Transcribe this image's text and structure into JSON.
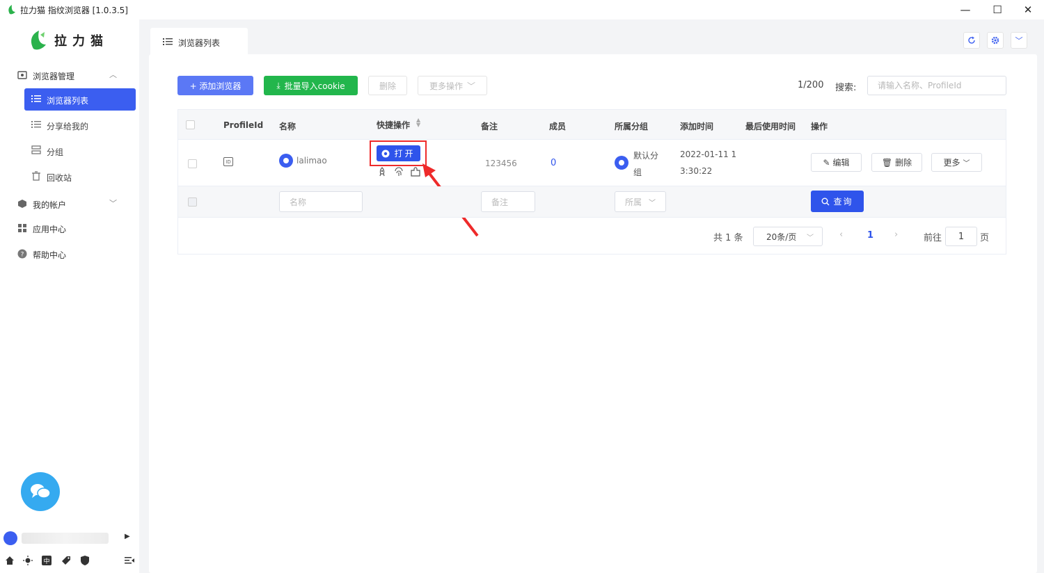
{
  "window": {
    "title": "拉力猫 指纹浏览器  [1.0.3.5]",
    "minimize": "—",
    "maximize": "☐",
    "close": "✕"
  },
  "sidebar": {
    "logo_text": "拉力猫",
    "groups": [
      {
        "label": "浏览器管理",
        "icon": "browser-manage-icon",
        "expanded": true
      },
      {
        "label": "我的帐户",
        "icon": "account-icon",
        "expanded": false
      },
      {
        "label": "应用中心",
        "icon": "app-center-icon"
      },
      {
        "label": "帮助中心",
        "icon": "help-icon"
      }
    ],
    "sub_items": [
      {
        "label": "浏览器列表",
        "active": true
      },
      {
        "label": "分享给我的"
      },
      {
        "label": "分组"
      },
      {
        "label": "回收站"
      }
    ]
  },
  "tab": {
    "label": "浏览器列表"
  },
  "toolbar": {
    "add_label": "+ 添加浏览器",
    "import_label": "批量导入cookie",
    "delete_label": "删除",
    "more_label": "更多操作",
    "counter": "1/200",
    "search_label": "搜索:",
    "search_placeholder": "请输入名称、ProfileId"
  },
  "table": {
    "headers": [
      "ProfileId",
      "名称",
      "快捷操作",
      "备注",
      "成员",
      "所属分组",
      "添加时间",
      "最后使用时间",
      "操作"
    ],
    "rows": [
      {
        "name": "lalimao",
        "open_label": "打开",
        "remark": "123456",
        "members": "0",
        "group_line1": "默认分",
        "group_line2": "组",
        "added_line1": "2022-01-11 1",
        "added_line2": "3:30:22",
        "edit_label": "编辑",
        "delete_label": "删除",
        "more_label": "更多"
      }
    ],
    "filters": {
      "name_placeholder": "名称",
      "remark_placeholder": "备注",
      "group_placeholder": "所属",
      "query_label": "查询"
    }
  },
  "pagination": {
    "total": "共 1 条",
    "page_size": "20条/页",
    "current_page": "1",
    "goto_label": "前往",
    "goto_value": "1",
    "page_suffix": "页"
  },
  "colors": {
    "primary": "#2f54eb",
    "green": "#22b64c",
    "highlight": "#ee2a2a",
    "chat": "#35aaf0"
  }
}
